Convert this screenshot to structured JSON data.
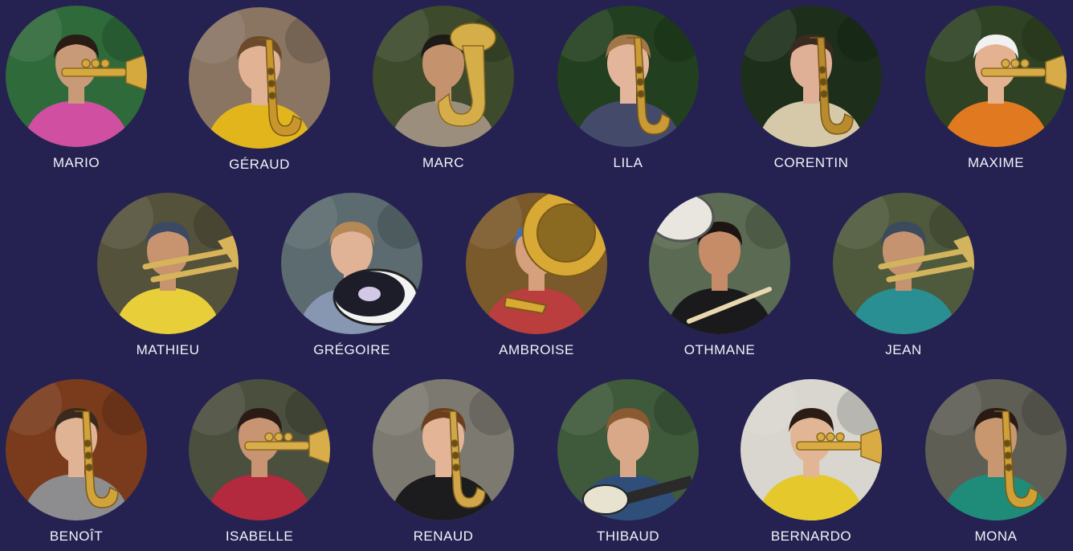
{
  "members": [
    {
      "name": "MARIO",
      "instrument": "trumpet",
      "bg": "#2f6a3a",
      "shirt": "#d04fa0",
      "skin": "#c99a77",
      "hair": "#2a1c15",
      "metal": "#d6a93f"
    },
    {
      "name": "GÉRAUD",
      "instrument": "saxophone",
      "bg": "#8a7563",
      "shirt": "#e2b51c",
      "skin": "#e1b394",
      "hair": "#6b4a2c",
      "metal": "#c9962e"
    },
    {
      "name": "MARC",
      "instrument": "euphonium",
      "bg": "#3d4a2c",
      "shirt": "#9b8e7d",
      "skin": "#c4926d",
      "hair": "#1d1a18",
      "metal": "#d6ae49"
    },
    {
      "name": "LILA",
      "instrument": "saxophone",
      "bg": "#22401f",
      "shirt": "#434a6a",
      "skin": "#e3b69b",
      "hair": "#a27649",
      "metal": "#c99a35"
    },
    {
      "name": "CORENTIN",
      "instrument": "saxophone",
      "bg": "#1d2f1a",
      "shirt": "#d6c9aa",
      "skin": "#dfb095",
      "hair": "#3b2a20",
      "metal": "#b98b2f"
    },
    {
      "name": "MAXIME",
      "instrument": "trumpet",
      "bg": "#2f4324",
      "shirt": "#e0791f",
      "skin": "#e4b291",
      "hair": "#f1f1f1",
      "metal": "#d7ac48"
    },
    {
      "name": "MATHIEU",
      "instrument": "trombone",
      "bg": "#55523b",
      "shirt": "#e8cf3a",
      "skin": "#c8946f",
      "hair": "#3b4a62",
      "metal": "#d7b45a"
    },
    {
      "name": "GRÉGOIRE",
      "instrument": "drum",
      "bg": "#5c6b6f",
      "shirt": "#8797b2",
      "skin": "#e0b397",
      "hair": "#b58857",
      "metal": "#ffffff"
    },
    {
      "name": "AMBROISE",
      "instrument": "sousaphone",
      "bg": "#7a5a2a",
      "shirt": "#b93e3d",
      "skin": "#d6a07c",
      "hair": "#3c6fb8",
      "metal": "#d9a936"
    },
    {
      "name": "OTHMANE",
      "instrument": "drumstick",
      "bg": "#5b6a52",
      "shirt": "#1a1a1c",
      "skin": "#c58c67",
      "hair": "#1c1512",
      "metal": "#e8d8b0"
    },
    {
      "name": "JEAN",
      "instrument": "trombone",
      "bg": "#4f5a3c",
      "shirt": "#2a8f93",
      "skin": "#c69370",
      "hair": "#3c4a5e",
      "metal": "#d3b45e"
    },
    {
      "name": "BENOÎT",
      "instrument": "saxophone",
      "bg": "#7a3b1c",
      "shirt": "#8d8d8f",
      "skin": "#e0b394",
      "hair": "#3a2a1c",
      "metal": "#d2a23b"
    },
    {
      "name": "ISABELLE",
      "instrument": "trumpet",
      "bg": "#4b4f3e",
      "shirt": "#b3293d",
      "skin": "#c99472",
      "hair": "#2a1b16",
      "metal": "#d8ad4a"
    },
    {
      "name": "RENAUD",
      "instrument": "saxophone",
      "bg": "#7c7a70",
      "shirt": "#1c1c1e",
      "skin": "#e3b596",
      "hair": "#6b3e1e",
      "metal": "#d1a64a"
    },
    {
      "name": "THIBAUD",
      "instrument": "guitar",
      "bg": "#3e5a3a",
      "shirt": "#2f4f7a",
      "skin": "#d8a888",
      "hair": "#8a5a33",
      "metal": "#c9b890"
    },
    {
      "name": "BERNARDO",
      "instrument": "trumpet",
      "bg": "#d8d6cf",
      "shirt": "#e5c92c",
      "skin": "#e2b695",
      "hair": "#2b1d15",
      "metal": "#d9ab42"
    },
    {
      "name": "MONA",
      "instrument": "saxophone",
      "bg": "#5e5e55",
      "shirt": "#1f8c7a",
      "skin": "#c8976f",
      "hair": "#2a1a14",
      "metal": "#cf9f38"
    }
  ]
}
